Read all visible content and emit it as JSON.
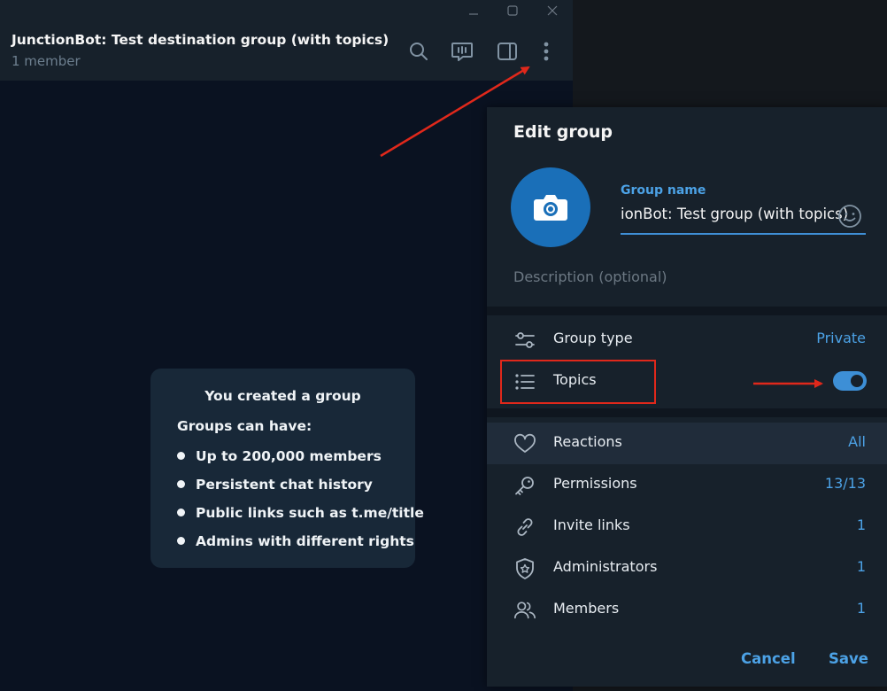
{
  "window": {
    "controls": {
      "minimize": "minimize-icon",
      "maximize": "maximize-icon",
      "close": "close-icon"
    }
  },
  "chat_header": {
    "title": "JunctionBot: Test destination group (with topics)",
    "subtitle": "1 member",
    "icons": [
      "search-icon",
      "live-stream-icon",
      "sidebar-toggle-icon",
      "more-vertical-icon"
    ]
  },
  "info_card": {
    "title": "You created a group",
    "subtitle": "Groups can have:",
    "items": [
      "Up to 200,000 members",
      "Persistent chat history",
      "Public links such as t.me/title",
      "Admins with different rights"
    ]
  },
  "edit_group": {
    "title": "Edit group",
    "name_label": "Group name",
    "name_value": "ionBot: Test group (with topics)",
    "description_placeholder": "Description (optional)",
    "settings": [
      {
        "label": "Group type",
        "value": "Private",
        "icon": "group-type-icon"
      },
      {
        "label": "Topics",
        "value": "",
        "icon": "topics-list-icon",
        "toggle": true,
        "toggle_on": true
      }
    ],
    "rows": [
      {
        "label": "Reactions",
        "value": "All",
        "icon": "heart-icon"
      },
      {
        "label": "Permissions",
        "value": "13/13",
        "icon": "key-icon"
      },
      {
        "label": "Invite links",
        "value": "1",
        "icon": "link-icon"
      },
      {
        "label": "Administrators",
        "value": "1",
        "icon": "shield-star-icon"
      },
      {
        "label": "Members",
        "value": "1",
        "icon": "members-icon"
      }
    ],
    "cancel_label": "Cancel",
    "save_label": "Save"
  },
  "colors": {
    "accent": "#4ca2e6",
    "panel_bg": "#17212b",
    "chat_bg": "#0a1221",
    "annotation": "#e0281b"
  }
}
